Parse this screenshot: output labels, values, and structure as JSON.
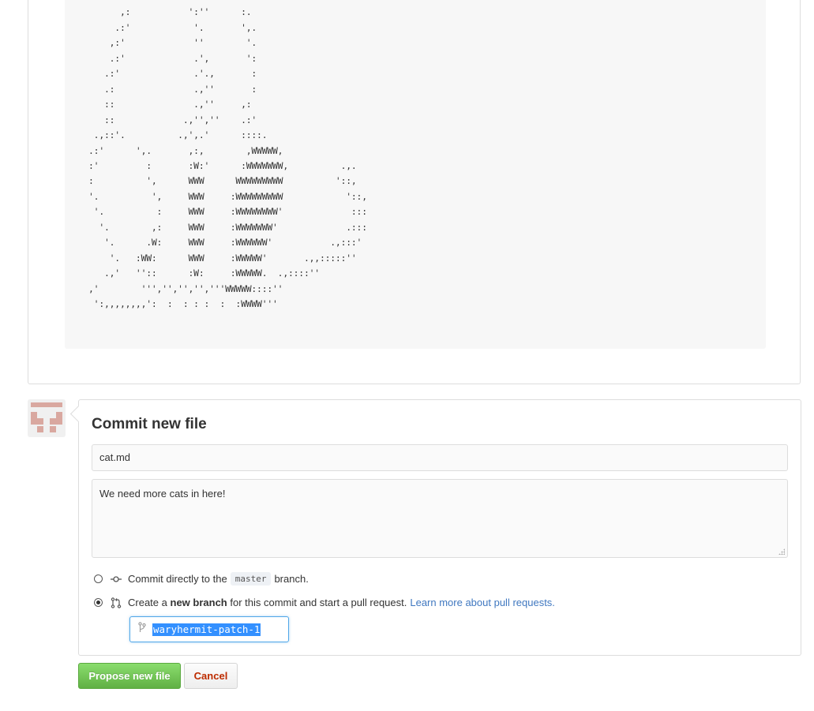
{
  "file_preview": {
    "ascii_art": "       :           :::       :\n      ,:           ':''      :.\n     .:'            '.       ',.\n    ,:'             ''        '.\n    .:'             .',       ':\n   .:'              .'.,       :\n   .:               .,''       :\n   ::               .,''     ,:\n   ::             .,'',''    .:'\n .,::'.          .,',.'      ::::.\n.:'      ',.       ,:,        ,WWWWW,\n:'         :       :W:'      :WWWWWWW,          .,.\n:          ',      WWW      WWWWWWWWW          '::,\n'.          ',     WWW     :WWWWWWWWW            '::,\n '.          :     WWW     :WWWWWWWW'             :::\n  '.        ,:     WWW     :WWWWWWW'             .:::\n   '.      .W:     WWW     :WWWWWW'           .,:::'\n    '.   :WW:      WWW     :WWWWW'       .,,:::::''\n   .,'   ''::      :W:     :WWWWW.  .,::::''\n,'        ''','','','','''WWWWW::::''\n ':,,,,,,,,':  :  : : :  :  :WWWW'''"
  },
  "commit": {
    "title": "Commit new file",
    "summary_value": "cat.md",
    "description_value": "We need more cats in here!",
    "option_direct": {
      "prefix": "Commit directly to the",
      "branch": "master",
      "suffix": "branch.",
      "selected": false
    },
    "option_new_branch": {
      "prefix": "Create a",
      "bold": "new branch",
      "suffix": "for this commit and start a pull request.",
      "link": "Learn more about pull requests.",
      "selected": true
    },
    "branch_name_value": "waryhermit-patch-1"
  },
  "buttons": {
    "propose_label": "Propose new file",
    "cancel_label": "Cancel"
  },
  "colors": {
    "primary_green": "#60b044",
    "cancel_red": "#bd2c00",
    "link_blue": "#4078c0",
    "focus_blue": "#51a7e8",
    "avatar_pink": "#d9a8a0"
  },
  "icons": {
    "commit": "git-commit-icon",
    "pull_request": "git-pull-request-icon",
    "branch": "git-branch-icon"
  }
}
